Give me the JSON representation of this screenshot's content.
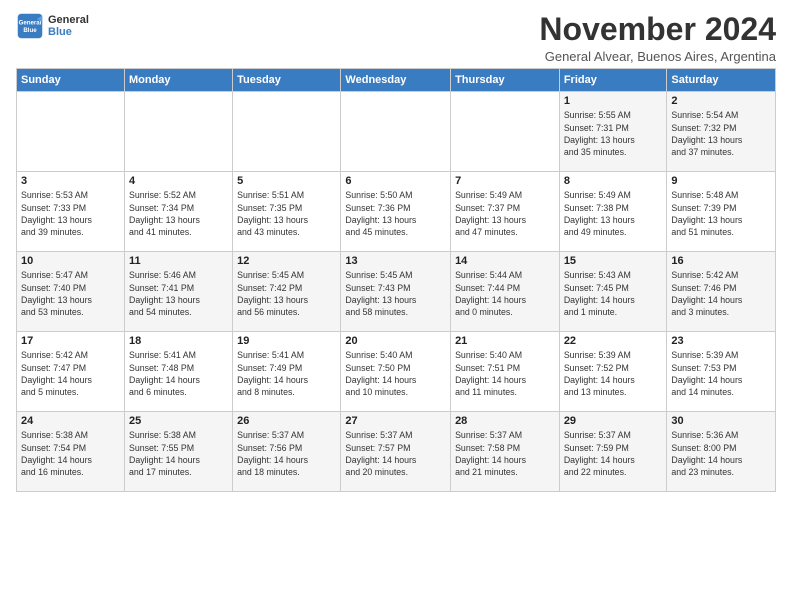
{
  "logo": {
    "line1": "General",
    "line2": "Blue"
  },
  "title": "November 2024",
  "subtitle": "General Alvear, Buenos Aires, Argentina",
  "header": {
    "days": [
      "Sunday",
      "Monday",
      "Tuesday",
      "Wednesday",
      "Thursday",
      "Friday",
      "Saturday"
    ]
  },
  "weeks": [
    [
      {
        "day": "",
        "info": ""
      },
      {
        "day": "",
        "info": ""
      },
      {
        "day": "",
        "info": ""
      },
      {
        "day": "",
        "info": ""
      },
      {
        "day": "",
        "info": ""
      },
      {
        "day": "1",
        "info": "Sunrise: 5:55 AM\nSunset: 7:31 PM\nDaylight: 13 hours\nand 35 minutes."
      },
      {
        "day": "2",
        "info": "Sunrise: 5:54 AM\nSunset: 7:32 PM\nDaylight: 13 hours\nand 37 minutes."
      }
    ],
    [
      {
        "day": "3",
        "info": "Sunrise: 5:53 AM\nSunset: 7:33 PM\nDaylight: 13 hours\nand 39 minutes."
      },
      {
        "day": "4",
        "info": "Sunrise: 5:52 AM\nSunset: 7:34 PM\nDaylight: 13 hours\nand 41 minutes."
      },
      {
        "day": "5",
        "info": "Sunrise: 5:51 AM\nSunset: 7:35 PM\nDaylight: 13 hours\nand 43 minutes."
      },
      {
        "day": "6",
        "info": "Sunrise: 5:50 AM\nSunset: 7:36 PM\nDaylight: 13 hours\nand 45 minutes."
      },
      {
        "day": "7",
        "info": "Sunrise: 5:49 AM\nSunset: 7:37 PM\nDaylight: 13 hours\nand 47 minutes."
      },
      {
        "day": "8",
        "info": "Sunrise: 5:49 AM\nSunset: 7:38 PM\nDaylight: 13 hours\nand 49 minutes."
      },
      {
        "day": "9",
        "info": "Sunrise: 5:48 AM\nSunset: 7:39 PM\nDaylight: 13 hours\nand 51 minutes."
      }
    ],
    [
      {
        "day": "10",
        "info": "Sunrise: 5:47 AM\nSunset: 7:40 PM\nDaylight: 13 hours\nand 53 minutes."
      },
      {
        "day": "11",
        "info": "Sunrise: 5:46 AM\nSunset: 7:41 PM\nDaylight: 13 hours\nand 54 minutes."
      },
      {
        "day": "12",
        "info": "Sunrise: 5:45 AM\nSunset: 7:42 PM\nDaylight: 13 hours\nand 56 minutes."
      },
      {
        "day": "13",
        "info": "Sunrise: 5:45 AM\nSunset: 7:43 PM\nDaylight: 13 hours\nand 58 minutes."
      },
      {
        "day": "14",
        "info": "Sunrise: 5:44 AM\nSunset: 7:44 PM\nDaylight: 14 hours\nand 0 minutes."
      },
      {
        "day": "15",
        "info": "Sunrise: 5:43 AM\nSunset: 7:45 PM\nDaylight: 14 hours\nand 1 minute."
      },
      {
        "day": "16",
        "info": "Sunrise: 5:42 AM\nSunset: 7:46 PM\nDaylight: 14 hours\nand 3 minutes."
      }
    ],
    [
      {
        "day": "17",
        "info": "Sunrise: 5:42 AM\nSunset: 7:47 PM\nDaylight: 14 hours\nand 5 minutes."
      },
      {
        "day": "18",
        "info": "Sunrise: 5:41 AM\nSunset: 7:48 PM\nDaylight: 14 hours\nand 6 minutes."
      },
      {
        "day": "19",
        "info": "Sunrise: 5:41 AM\nSunset: 7:49 PM\nDaylight: 14 hours\nand 8 minutes."
      },
      {
        "day": "20",
        "info": "Sunrise: 5:40 AM\nSunset: 7:50 PM\nDaylight: 14 hours\nand 10 minutes."
      },
      {
        "day": "21",
        "info": "Sunrise: 5:40 AM\nSunset: 7:51 PM\nDaylight: 14 hours\nand 11 minutes."
      },
      {
        "day": "22",
        "info": "Sunrise: 5:39 AM\nSunset: 7:52 PM\nDaylight: 14 hours\nand 13 minutes."
      },
      {
        "day": "23",
        "info": "Sunrise: 5:39 AM\nSunset: 7:53 PM\nDaylight: 14 hours\nand 14 minutes."
      }
    ],
    [
      {
        "day": "24",
        "info": "Sunrise: 5:38 AM\nSunset: 7:54 PM\nDaylight: 14 hours\nand 16 minutes."
      },
      {
        "day": "25",
        "info": "Sunrise: 5:38 AM\nSunset: 7:55 PM\nDaylight: 14 hours\nand 17 minutes."
      },
      {
        "day": "26",
        "info": "Sunrise: 5:37 AM\nSunset: 7:56 PM\nDaylight: 14 hours\nand 18 minutes."
      },
      {
        "day": "27",
        "info": "Sunrise: 5:37 AM\nSunset: 7:57 PM\nDaylight: 14 hours\nand 20 minutes."
      },
      {
        "day": "28",
        "info": "Sunrise: 5:37 AM\nSunset: 7:58 PM\nDaylight: 14 hours\nand 21 minutes."
      },
      {
        "day": "29",
        "info": "Sunrise: 5:37 AM\nSunset: 7:59 PM\nDaylight: 14 hours\nand 22 minutes."
      },
      {
        "day": "30",
        "info": "Sunrise: 5:36 AM\nSunset: 8:00 PM\nDaylight: 14 hours\nand 23 minutes."
      }
    ]
  ]
}
